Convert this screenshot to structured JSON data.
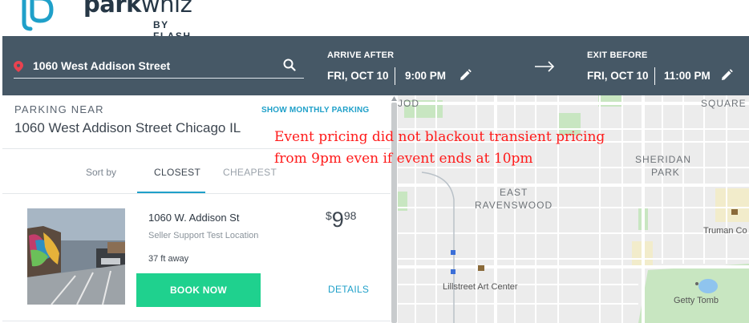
{
  "brand": {
    "name_bold": "park",
    "name_thin": "whiz",
    "by_line": "BY FLASH"
  },
  "search": {
    "address": "1060 West Addison Street"
  },
  "arrive": {
    "label": "ARRIVE AFTER",
    "date": "FRI, OCT 10",
    "time": "9:00 PM"
  },
  "exit": {
    "label": "EXIT BEFORE",
    "date": "FRI, OCT 10",
    "time": "11:00 PM"
  },
  "panel": {
    "heading": "PARKING NEAR",
    "monthly_link": "SHOW MONTHLY PARKING",
    "address": "1060 West Addison Street Chicago IL",
    "sort_by": "Sort by",
    "tabs": [
      "CLOSEST",
      "CHEAPEST"
    ]
  },
  "listing": {
    "name": "1060 W. Addison St",
    "subtitle": "Seller Support Test Location",
    "distance": "37 ft away",
    "price_currency": "$",
    "price_dollars": "9",
    "price_cents": "98",
    "book_label": "BOOK NOW",
    "details_label": "DETAILS"
  },
  "map": {
    "labels": {
      "top_left": "JOD",
      "top_right": "SQUARE",
      "sheridan_1": "SHERIDAN",
      "sheridan_2": "PARK",
      "east_1": "EAST",
      "east_2": "RAVENSWOOD",
      "art_center": "Lillstreet Art Center",
      "truman": "Truman Co",
      "getty": "Getty Tomb"
    }
  },
  "annotation": {
    "line1": "Event pricing did not blackout transient pricing",
    "line2": "from 9pm even if event ends at 10pm"
  },
  "colors": {
    "header": "#465866",
    "accent": "#1fa0c9",
    "book": "#1fd18e",
    "annotation": "#ff1a1a",
    "pin": "#e8424f"
  }
}
